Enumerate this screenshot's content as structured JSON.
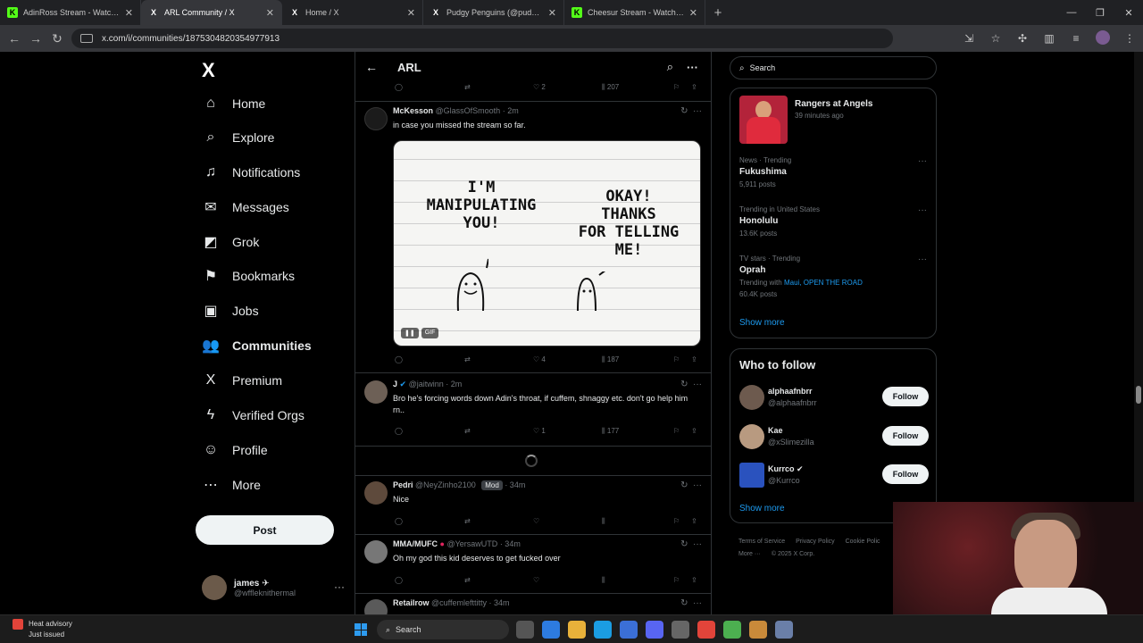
{
  "browser": {
    "tabs": [
      {
        "label": "AdinRoss Stream - Watch Li...",
        "fav": "K",
        "favclass": "kick",
        "active": false
      },
      {
        "label": "ARL Community / X",
        "fav": "X",
        "favclass": "x",
        "active": true
      },
      {
        "label": "Home / X",
        "fav": "X",
        "favclass": "x",
        "active": false
      },
      {
        "label": "Pudgy Penguins (@pudgypeng...",
        "fav": "X",
        "favclass": "x",
        "active": false
      },
      {
        "label": "Cheesur Stream - Watch Live o...",
        "fav": "K",
        "favclass": "kick",
        "active": false
      }
    ],
    "url": "x.com/i/communities/1875304820354977913"
  },
  "nav": {
    "logo": "X",
    "items": [
      {
        "label": "Home",
        "icon": "⌂",
        "icon_name": "home-icon"
      },
      {
        "label": "Explore",
        "icon": "⌕",
        "icon_name": "explore-icon"
      },
      {
        "label": "Notifications",
        "icon": "♫",
        "icon_name": "bell-icon"
      },
      {
        "label": "Messages",
        "icon": "✉",
        "icon_name": "mail-icon"
      },
      {
        "label": "Grok",
        "icon": "◩",
        "icon_name": "grok-icon"
      },
      {
        "label": "Bookmarks",
        "icon": "⚑",
        "icon_name": "bookmark-icon"
      },
      {
        "label": "Jobs",
        "icon": "▣",
        "icon_name": "briefcase-icon"
      },
      {
        "label": "Communities",
        "icon": "👥",
        "icon_name": "communities-icon"
      },
      {
        "label": "Premium",
        "icon": "X",
        "icon_name": "premium-icon"
      },
      {
        "label": "Verified Orgs",
        "icon": "ϟ",
        "icon_name": "lightning-icon"
      },
      {
        "label": "Profile",
        "icon": "☺",
        "icon_name": "profile-icon"
      },
      {
        "label": "More",
        "icon": "⋯",
        "icon_name": "more-circle-icon"
      }
    ],
    "post_label": "Post",
    "user": {
      "name": "james ✈",
      "handle": "@wffleknithermal"
    }
  },
  "feed": {
    "title": "ARL",
    "top_actions": {
      "likes": "2",
      "views": "207"
    },
    "tweets": [
      {
        "name": "McKesson",
        "handle": "@GlassOfSmooth",
        "time": "· 2m",
        "text": "in case you missed the stream so far.",
        "gif_left": "I'M\nMANIPULATING\nYOU!",
        "gif_right": "OKAY!\nTHANKS\nFOR TELLING\nME!",
        "gif_tag": "GIF",
        "likes": "4",
        "views": "187"
      },
      {
        "name": "J",
        "handle": "@jaitwinn",
        "time": "· 2m",
        "text": "Bro he's forcing words down Adin's throat, if cuffem, shnaggy etc. don't go help him rn..",
        "likes": "1",
        "views": "177"
      },
      {
        "name": "Pedri",
        "handle": "@NeyZinho2100",
        "badge": "Mod",
        "time": "· 34m",
        "text": "Nice"
      },
      {
        "name": "MMA/MUFC",
        "handle": "@YersawUTD",
        "time": "· 34m",
        "text": "Oh my god this kid deserves to get fucked over"
      },
      {
        "name": "Retailrow",
        "handle": "@cuffemlefttitty",
        "time": "· 34m",
        "text": ""
      }
    ]
  },
  "sidebar": {
    "search_placeholder": "Search",
    "live": {
      "title": "Rangers at Angels",
      "sub": "39 minutes ago"
    },
    "trends": [
      {
        "cat": "News · Trending",
        "name": "Fukushima",
        "count": "5,911 posts"
      },
      {
        "cat": "Trending in United States",
        "name": "Honolulu",
        "count": "13.6K posts"
      },
      {
        "cat": "TV stars · Trending",
        "name": "Oprah",
        "with_label": "Trending with",
        "with": "Maui, OPEN THE ROAD",
        "count": "60.4K posts"
      }
    ],
    "show_more": "Show more",
    "wtf_title": "Who to follow",
    "people": [
      {
        "name": "alphaafnbrr",
        "handle": "@alphaafnbrr",
        "color": "#6d5a4e"
      },
      {
        "name": "Kae",
        "handle": "@xSlimezilla",
        "color": "#b89a80"
      },
      {
        "name": "Kurrco ✔",
        "handle": "@Kurrco",
        "color": "#2a52be"
      }
    ],
    "follow_label": "Follow",
    "footer": [
      "Terms of Service",
      "Privacy Policy",
      "Cookie Polic",
      "More ···",
      "© 2025 X Corp."
    ]
  },
  "taskbar": {
    "weather_title": "Heat advisory",
    "weather_sub": "Just issued",
    "search": "Search"
  }
}
